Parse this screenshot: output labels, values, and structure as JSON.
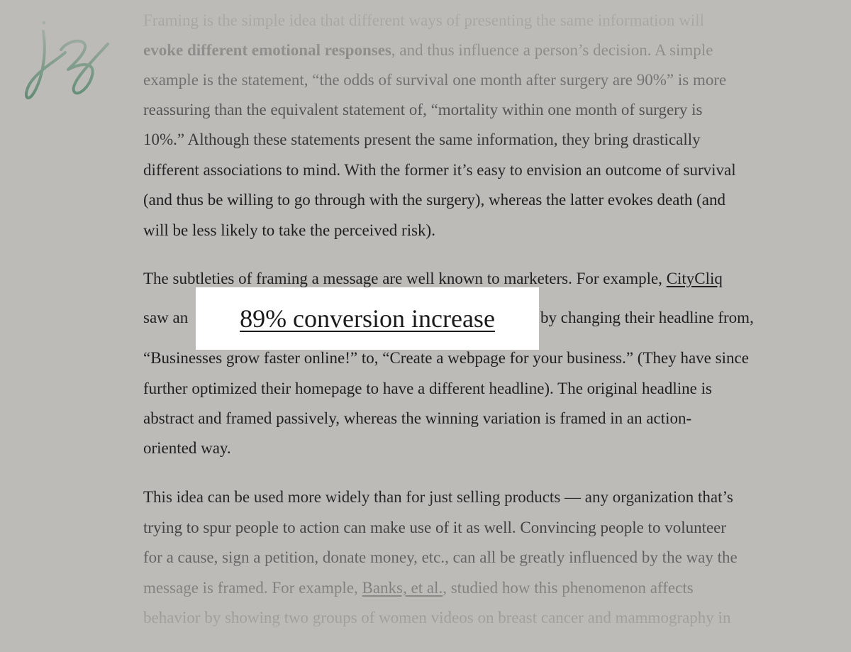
{
  "logo": {
    "text": "jz",
    "color": "#1f6b45"
  },
  "article": {
    "p1": {
      "l1": "Framing is the simple idea that different ways of presenting the same information will",
      "l2_bold": "evoke different emotional responses",
      "l2_rest": ", and thus influence a person’s decision. A simple",
      "l3": "example is the statement, “the odds of survival one month after surgery are 90%” is more",
      "l4": "reassuring than the equivalent statement of, “mortality within one month of surgery is",
      "l5": "10%.” Although these statements present the same information, they bring drastically",
      "l6": "different associations to mind. With the former it’s easy to envision an outcome of survival",
      "l7": "(and thus be willing to go through with the surgery), whereas the latter evokes death (and",
      "l8": "will be less likely to take the perceived risk)."
    },
    "p2": {
      "l1_text": "The subtleties of framing a message are well known to marketers. For example, ",
      "l1_link": "CityCliq",
      "l2_start": "saw an",
      "l2_end": "by changing their headline from,",
      "l3": "“Businesses grow faster online!” to, “Create a webpage for your business.” (They have since",
      "l4": "further optimized their homepage to have a different headline). The original headline is",
      "l5": "abstract and framed passively, whereas the winning variation is framed in an action-",
      "l6": "oriented way."
    },
    "p3": {
      "l1": "This idea can be used more widely than for just selling products — any organization that’s",
      "l2": "trying to spur people to action can make use of it as well. Convincing people to volunteer",
      "l3": "for a cause, sign a petition, donate money, etc., can all be greatly influenced by the way the",
      "l4_text": "message is framed. For example, ",
      "l4_link": "Banks, et al.",
      "l4_rest": ", studied how this phenomenon affects",
      "l5": "behavior by showing two groups of women videos on breast cancer and mammography in"
    }
  },
  "callout": {
    "link": "89% conversion increase"
  }
}
